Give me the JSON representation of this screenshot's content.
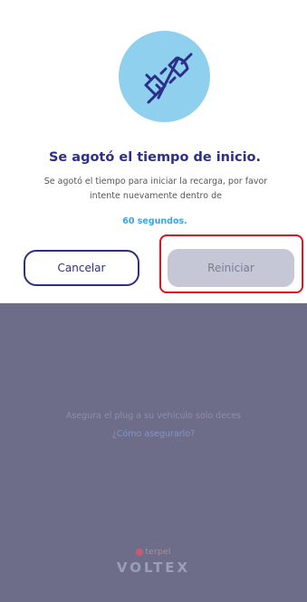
{
  "background": {
    "hint_text": "",
    "message": "Asegura el plug a su vehículo solo deces",
    "link_text": "¿Cómo asegurarlo?",
    "brand_top": "terpel",
    "brand_main": "VOLTEX"
  },
  "dialog": {
    "icon": "unplugged-icon",
    "title": "Se agotó el tiempo de inicio.",
    "description": "Se agotó el tiempo para iniciar la recarga, por favor intente nuevamente dentro de",
    "seconds": "60 segundos.",
    "cancel_label": "Cancelar",
    "restart_label": "Reiniciar"
  },
  "colors": {
    "accent": "#2b2f8a",
    "icon_bg": "#8fd0ef",
    "link": "#3aa6e0",
    "overlay": "#6d6d8a",
    "highlight": "#e0141c"
  }
}
